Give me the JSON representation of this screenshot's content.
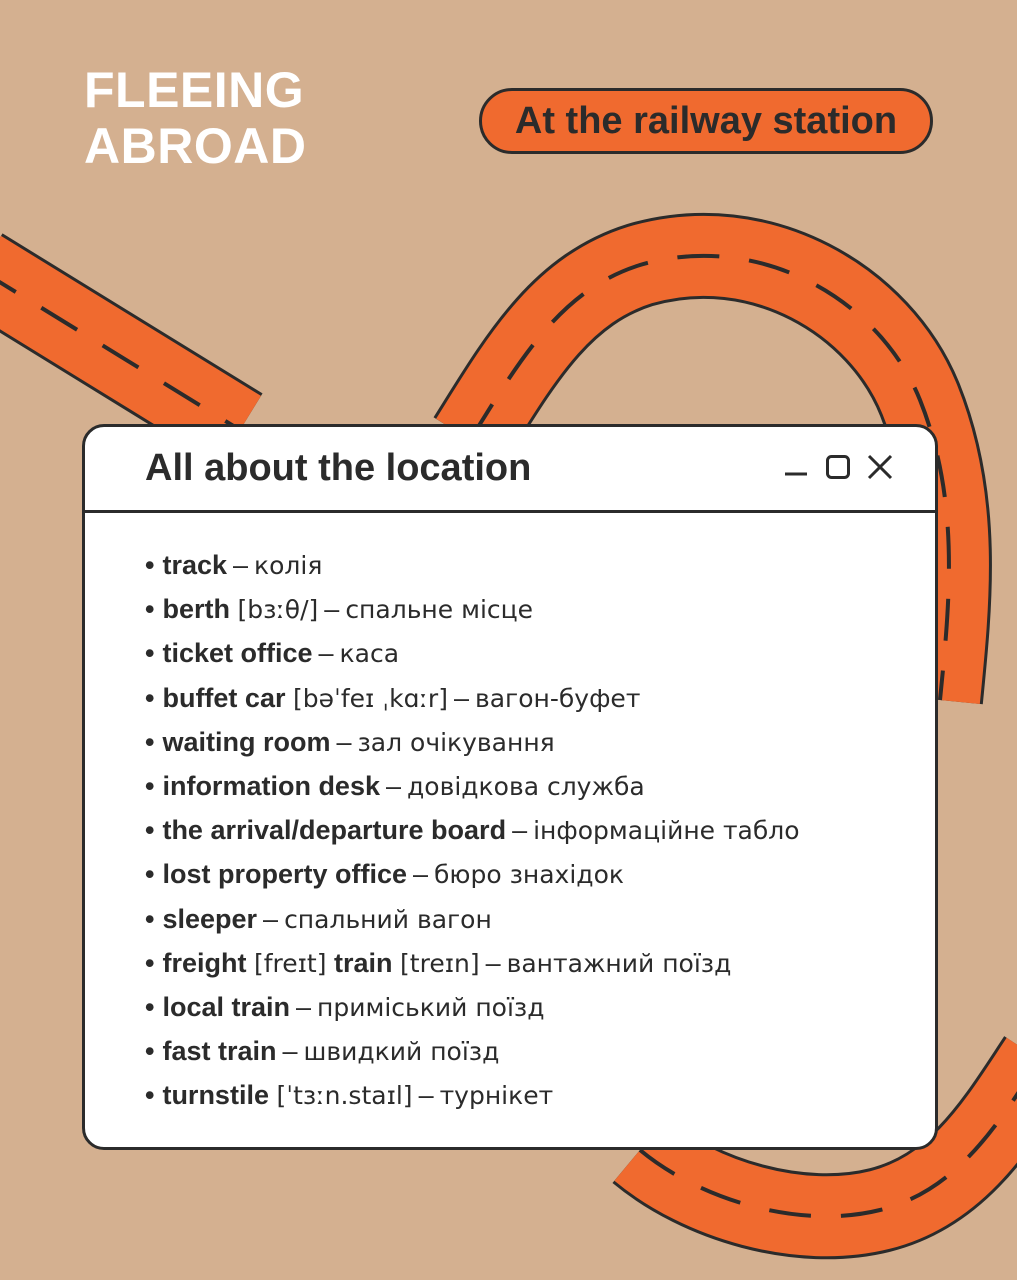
{
  "brand": {
    "line1": "FLEEING",
    "line2": "ABROAD"
  },
  "badge": {
    "label": "At the railway station"
  },
  "window": {
    "title": "All about the location",
    "controls": [
      "minimize-icon",
      "maximize-icon",
      "close-icon"
    ]
  },
  "colors": {
    "background": "#d4b090",
    "accent": "#f06a2f",
    "ink": "#2b2b2b",
    "window": "#ffffff"
  },
  "items": [
    {
      "bullet": "•",
      "term": "track",
      "dash": "–",
      "translation": "колія"
    },
    {
      "bullet": "•",
      "term": "berth",
      "pron": "[bɜːθ/]",
      "dash": "–",
      "translation": "спальне місце"
    },
    {
      "bullet": "•",
      "term": "ticket office",
      "dash": "–",
      "translation": "каса"
    },
    {
      "bullet": "•",
      "term": "buffet car",
      "pron": "[bəˈfeɪ ˌkɑːr]",
      "dash": "–",
      "translation": "вагон-буфет"
    },
    {
      "bullet": "•",
      "term": "waiting room",
      "dash": "–",
      "translation": "зал очікування"
    },
    {
      "bullet": "•",
      "term": "information desk",
      "dash": "–",
      "translation": "довідкова служба"
    },
    {
      "bullet": "•",
      "term": "the arrival/departure board",
      "dash": "–",
      "translation": "інформаційне табло"
    },
    {
      "bullet": "•",
      "term": "lost property office",
      "dash": "–",
      "translation": "бюро знахідок"
    },
    {
      "bullet": "•",
      "term": "sleeper",
      "dash": "–",
      "translation": "спальний вагон"
    },
    {
      "bullet": "•",
      "term": "freight",
      "pron": "[freɪt]",
      "term2": "train",
      "pron2": "[treɪn]",
      "dash": "–",
      "translation": "вантажний поїзд"
    },
    {
      "bullet": "•",
      "term": "local train",
      "dash": "–",
      "translation": "приміський поїзд"
    },
    {
      "bullet": "•",
      "term": "fast train",
      "dash": "–",
      "translation": "швидкий поїзд"
    },
    {
      "bullet": "•",
      "term": "turnstile",
      "pron": "[ˈtɜːn.staɪl]",
      "dash": "–",
      "translation": "турнікет"
    }
  ]
}
